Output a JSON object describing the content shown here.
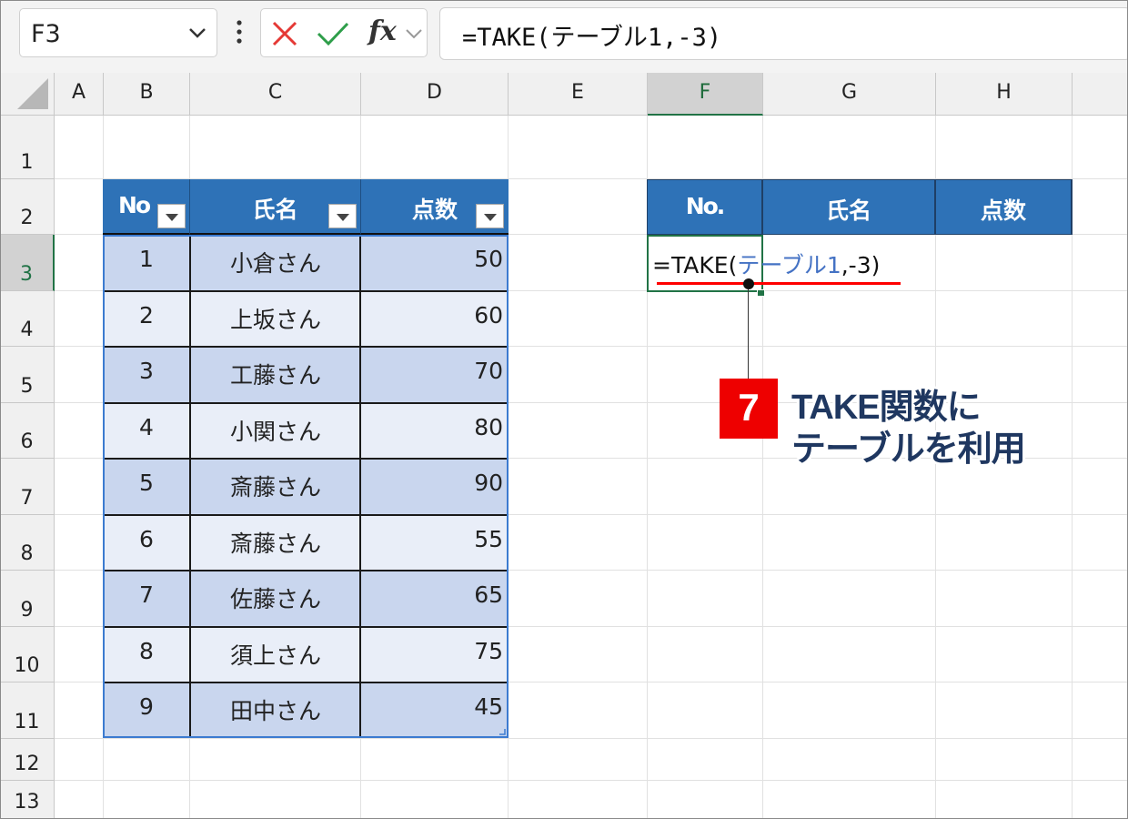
{
  "formula_bar": {
    "name_box": "F3",
    "formula": "=TAKE(テーブル1,-3)",
    "fx_label": "fx"
  },
  "columns": [
    "A",
    "B",
    "C",
    "D",
    "E",
    "F",
    "G",
    "H"
  ],
  "rows": [
    "1",
    "2",
    "3",
    "4",
    "5",
    "6",
    "7",
    "8",
    "9",
    "10",
    "11",
    "12",
    "13"
  ],
  "source_table": {
    "headers": [
      "No",
      "氏名",
      "点数"
    ],
    "rows": [
      [
        "1",
        "小倉さん",
        "50"
      ],
      [
        "2",
        "上坂さん",
        "60"
      ],
      [
        "3",
        "工藤さん",
        "70"
      ],
      [
        "4",
        "小関さん",
        "80"
      ],
      [
        "5",
        "斎藤さん",
        "90"
      ],
      [
        "6",
        "斎藤さん",
        "55"
      ],
      [
        "7",
        "佐藤さん",
        "65"
      ],
      [
        "8",
        "須上さん",
        "75"
      ],
      [
        "9",
        "田中さん",
        "45"
      ]
    ]
  },
  "result_table": {
    "headers": [
      "No.",
      "氏名",
      "点数"
    ],
    "formula_prefix": "=TAKE(",
    "formula_ref": "テーブル1",
    "formula_suffix": ",-3)"
  },
  "annotation": {
    "number": "7",
    "line1": "TAKE関数に",
    "line2": "テーブルを利用"
  },
  "colors": {
    "header_blue": "#2e72b7",
    "row_odd": "#c9d6ee",
    "row_even": "#e9eef8",
    "accent_green": "#217346",
    "callout_red": "#ee0000",
    "callout_text": "#1f3760"
  }
}
